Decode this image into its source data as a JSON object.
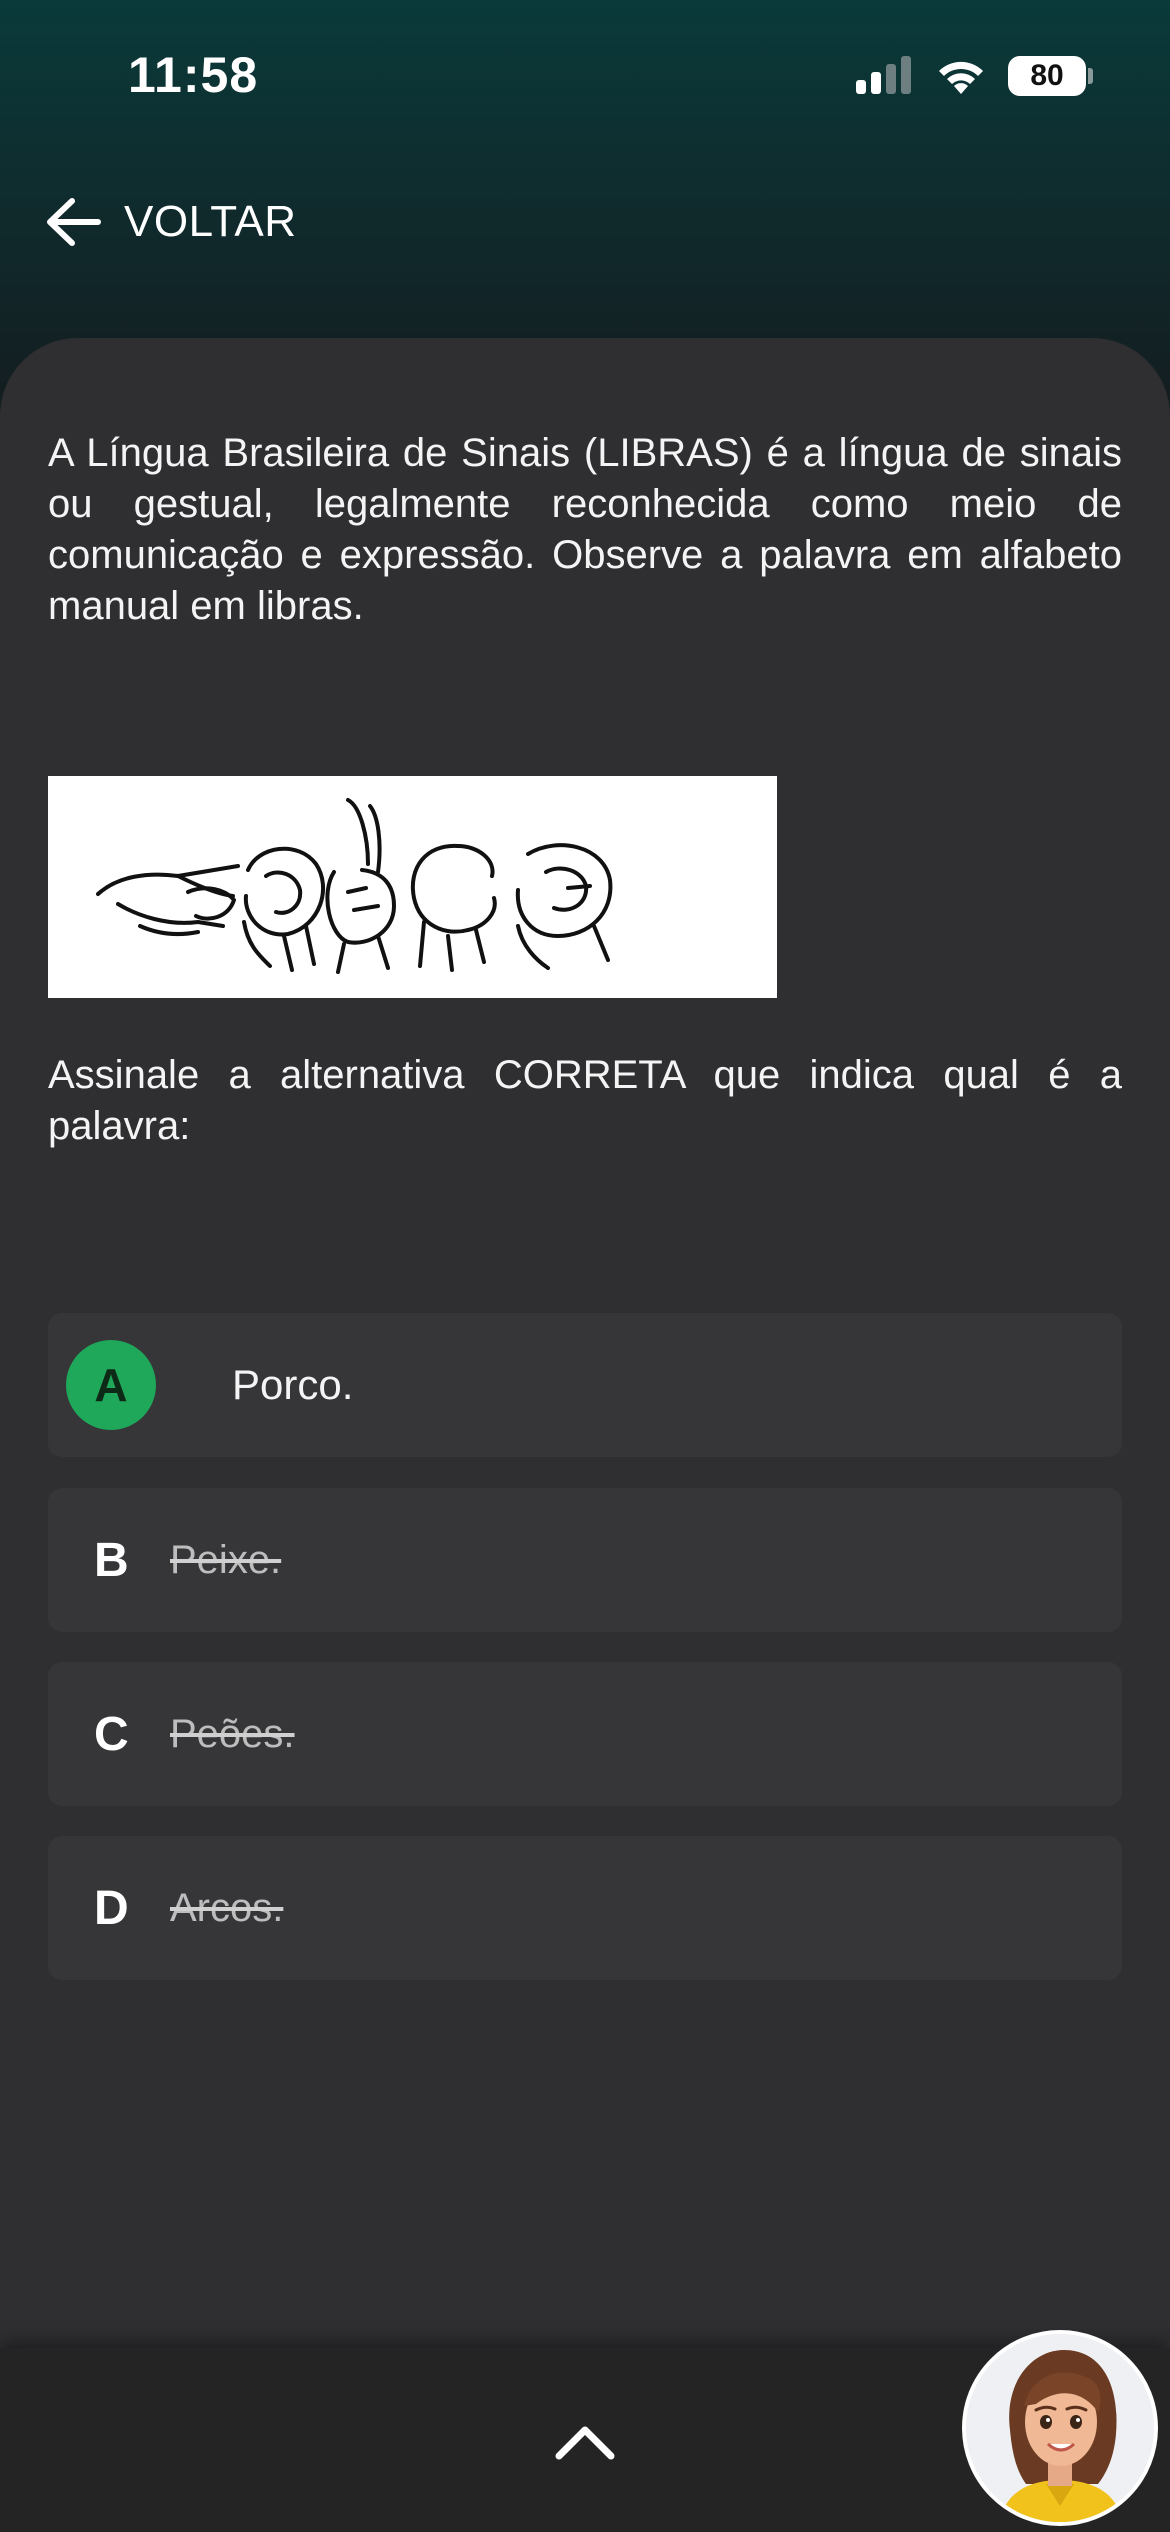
{
  "status_bar": {
    "time": "11:58",
    "battery": "80",
    "icons": [
      "signal-icon",
      "wifi-icon",
      "battery-icon"
    ]
  },
  "nav": {
    "back_label": "VOLTAR",
    "back_icon": "arrow-left-icon"
  },
  "question": {
    "text": "A Língua Brasileira de Sinais (LIBRAS) é a língua de sinais ou gestual, legalmente reconhecida como meio de comunicação e expressão. Observe a palavra em alfabeto manual em libras.",
    "image_description_icon": "libras-hands-image",
    "instruction": "Assinale a alternativa CORRETA que indica qual é a palavra:"
  },
  "options": [
    {
      "letter": "A",
      "text": "Porco.",
      "state": "correct"
    },
    {
      "letter": "B",
      "text": "Peixe.",
      "state": "eliminated"
    },
    {
      "letter": "C",
      "text": "Peões.",
      "state": "eliminated"
    },
    {
      "letter": "D",
      "text": "Arcos.",
      "state": "eliminated"
    }
  ],
  "colors": {
    "correct": "#1fa75a",
    "sheet_bg": "#2f2e31",
    "option_bg": "#363538",
    "header_bg": "#0a3a3a"
  },
  "bottom_bar": {
    "expand_icon": "chevron-up-icon",
    "assistant_icon": "assistant-avatar"
  }
}
